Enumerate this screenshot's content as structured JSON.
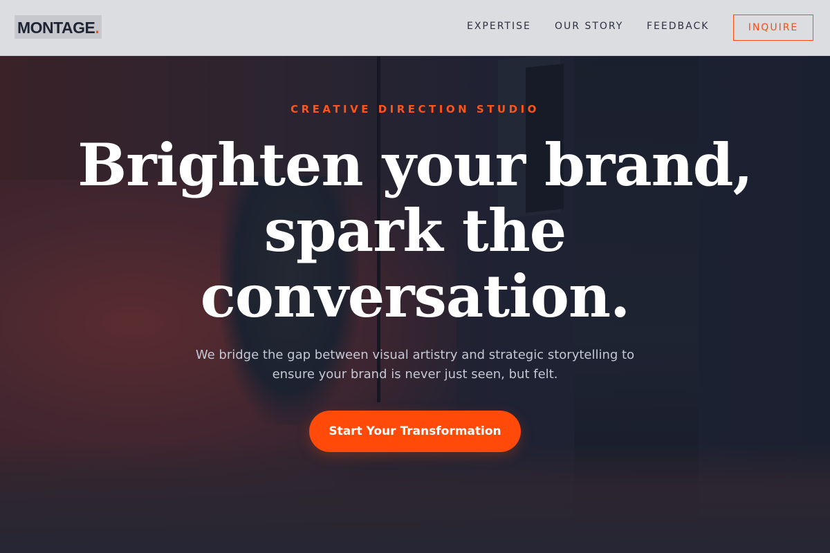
{
  "header": {
    "logo_text": "MONTAGE",
    "logo_dot": ".",
    "nav": [
      {
        "label": "EXPERTISE"
      },
      {
        "label": "OUR STORY"
      },
      {
        "label": "FEEDBACK"
      }
    ],
    "inquire_label": "INQUIRE"
  },
  "hero": {
    "eyebrow": "CREATIVE DIRECTION STUDIO",
    "headline_line1": "Brighten your brand,",
    "headline_line2": "spark the",
    "headline_line3": "conversation.",
    "subtext": "We bridge the gap between visual artistry and strategic storytelling to ensure your brand is never just seen, but felt.",
    "cta_label": "Start Your Transformation",
    "background_image": "photo-studio-scene"
  },
  "colors": {
    "accent": "#ff4a0a",
    "header_bg": "#dcdde1",
    "text_dark": "#1f2433",
    "hero_overlay": "#1c2030"
  }
}
